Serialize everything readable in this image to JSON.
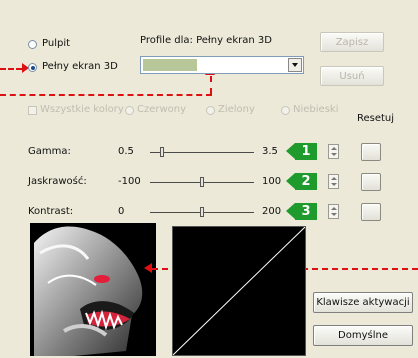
{
  "desktop_label": "Pulpit",
  "fullscreen_label": "Pełny ekran 3D",
  "profile_caption": "Profile dla: Pełny ekran 3D",
  "profile_value": "",
  "save_label": "Zapisz",
  "delete_label": "Usuń",
  "channels": {
    "all_label": "Wszystkie kolory",
    "red_label": "Czerwony",
    "green_label": "Zielony",
    "blue_label": "Niebieski"
  },
  "reset_label": "Resetuj",
  "sliders": [
    {
      "label": "Gamma:",
      "min": "0.5",
      "max": "3.5",
      "badge": "1",
      "position": 0.12
    },
    {
      "label": "Jaskrawość:",
      "min": "-100",
      "max": "100",
      "badge": "2",
      "position": 0.5
    },
    {
      "label": "Kontrast:",
      "min": "0",
      "max": "200",
      "badge": "3",
      "position": 0.5
    }
  ],
  "hotkeys_label": "Klawisze aktywacji",
  "defaults_label": "Domyślne",
  "colors": {
    "accent_green": "#1f9a2c",
    "annotation_red": "#dd1111"
  }
}
